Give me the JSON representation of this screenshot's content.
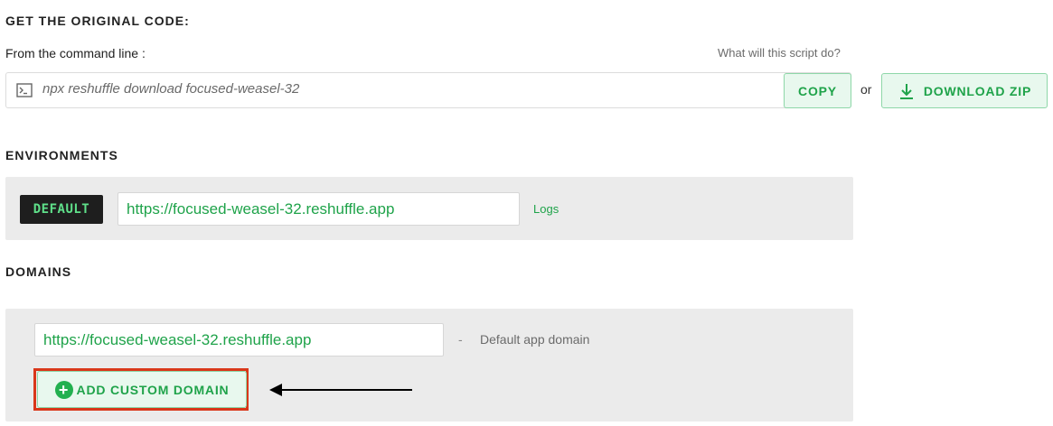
{
  "original_code": {
    "title": "GET THE ORIGINAL CODE:",
    "command_line_label": "From the command line :",
    "help_link": "What will this script do?",
    "command": "npx reshuffle download focused-weasel-32",
    "copy_label": "COPY",
    "or_text": "or",
    "download_label": "DOWNLOAD ZIP"
  },
  "environments": {
    "title": "ENVIRONMENTS",
    "badge": "DEFAULT",
    "url": "https://focused-weasel-32.reshuffle.app",
    "logs_label": "Logs"
  },
  "domains": {
    "title": "DOMAINS",
    "url": "https://focused-weasel-32.reshuffle.app",
    "separator": "-",
    "description": "Default app domain",
    "add_label": "ADD CUSTOM DOMAIN"
  },
  "colors": {
    "accent_green": "#1fa34a",
    "badge_text": "#5fe08a",
    "highlight": "#d9371a",
    "panel_bg": "#ebebeb"
  },
  "icons": [
    "terminal-icon",
    "download-icon",
    "plus-circle-icon",
    "arrow-left-icon"
  ]
}
